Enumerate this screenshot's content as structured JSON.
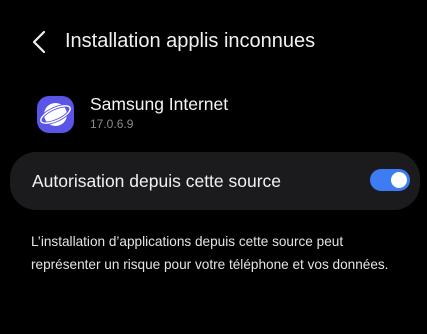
{
  "header": {
    "back_icon": "chevron-left-icon",
    "title": "Installation applis inconnues"
  },
  "app": {
    "icon": "samsung-internet-icon",
    "name": "Samsung Internet",
    "version": "17.0.6.9"
  },
  "permission": {
    "label": "Autorisation depuis cette source",
    "enabled": true
  },
  "warning": {
    "text": "L’installation d’applications depuis cette source peut représenter un risque pour votre téléphone et vos données."
  },
  "colors": {
    "background": "#000000",
    "card": "#1b1b1d",
    "accent": "#3e7cf3",
    "app_icon": "#5a55e6"
  }
}
